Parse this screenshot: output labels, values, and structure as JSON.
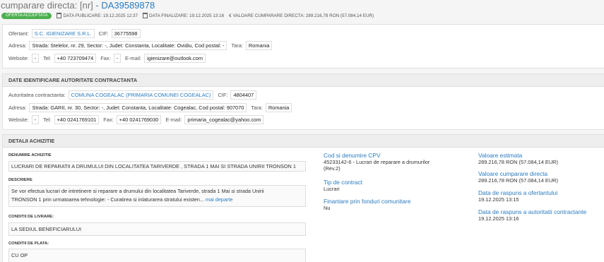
{
  "header": {
    "title_prefix": "cumparare directa: [nr] - ",
    "title_code": "DA39589878",
    "badge": "OFERTA ACCEPTATA",
    "data_publicare_label": "DATA PUBLICARE:",
    "data_publicare": "19.12.2025 12:37",
    "data_finalizare_label": "DATA FINALIZARE:",
    "data_finalizare": "19.12.2025 13:16",
    "valoare_label": "VALOARE CUMPARARE DIRECTA:",
    "valoare": "289.216,78  RON (57.084,14  EUR)"
  },
  "ofertant": {
    "label": "Ofertant:",
    "name": "S.C. IGIENIZARE S.R.L.",
    "cif_label": "CIF:",
    "cif": "36775598",
    "adresa_label": "Adresa:",
    "adresa": "Strada: Stelelor, nr. 29, Sector: -, Judet: Constanta, Localitate: Ovidiu, Cod postal: -",
    "tara_label": "Tara:",
    "tara": "Romania",
    "website_label": "Website:",
    "website": "-",
    "tel_label": "Tel:",
    "tel": "+40 723709474",
    "fax_label": "Fax:",
    "fax": "-",
    "email_label": "E-mail:",
    "email": "igienizare@outlook.com"
  },
  "autoritate": {
    "section_title": "DATE IDENTIFICARE AUTORITATE CONTRACTANTA",
    "label": "Autoritatea contractanta:",
    "name": "COMUNA COGEALAC (PRIMARIA COMUNEI COGEALAC)",
    "cif_label": "CIF:",
    "cif": "4804407",
    "adresa_label": "Adresa:",
    "adresa": "Strada: GARII, nr. 30, Sector: -, Judet: Constanta, Localitate: Cogealac, Cod postal: 907070",
    "tara_label": "Tara:",
    "tara": "Romania",
    "website_label": "Website:",
    "website": "-",
    "tel_label": "Tel:",
    "tel": "+40 0241769101",
    "fax_label": "Fax:",
    "fax": "+40 0241769030",
    "email_label": "E-mail:",
    "email": "primaria_cogealac@yahoo.com"
  },
  "detalii": {
    "section_title": "DETALII ACHIZITIE",
    "denumire_label": "DENUMIRE ACHIZITIE",
    "denumire": "LUCRARI DE REPARATII A DRUMULUI DIN LOCALITATEA TARIVERDE , STRADA 1 MAI SI STRADA UNIRII TRONSON 1",
    "descriere_label": "DESCRIERE",
    "descriere_line1": "Se vor efectua lucrari de intretinere si reparare a drumului din localitatea Tariverde, strada 1 Mai si strada Unirii",
    "descriere_line2": "TRONSON 1 prin urmatoarea tehnologie: - Curatirea si inlaturarea stratului existen...",
    "mai_departe": "mai departe",
    "livrare_label": "CONDITII DE LIVRARE:",
    "livrare": "LA SEDIUL BENEFICIARULUI",
    "plata_label": "CONDITII DE PLATA:",
    "plata": "CU OP",
    "cpv_label": "Cod si denumire CPV",
    "cpv_line1": "45233142-6 - Lucrari de reparare a drumurilor",
    "cpv_line2": "(Rev.2)",
    "tip_label": "Tip de contract",
    "tip": "Lucrari",
    "finantare_label": "Finantare prin fonduri comunitare",
    "finantare": "Nu",
    "estimata_label": "Valoare estimata",
    "estimata": "289.216,78  RON (57.084,14  EUR)",
    "cumparare_label": "Valoare cumparare directa",
    "cumparare": "289.216,78  RON (57.084,14  EUR)",
    "raspuns_ofertant_label": "Data de raspuns a ofertantului",
    "raspuns_ofertant": "19.12.2025 13:15",
    "raspuns_autoritate_label": "Data de raspuns a autoritatii contractante",
    "raspuns_autoritate": "19.12.2025 13:16"
  }
}
